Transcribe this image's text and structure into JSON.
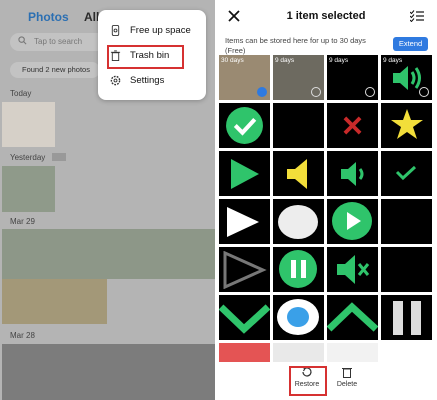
{
  "left": {
    "tabs": {
      "photos": "Photos",
      "albums": "Alb"
    },
    "search_placeholder": "Tap to search",
    "found_banner": "Found 2 new photos",
    "sections": [
      "Today",
      "Yesterday",
      "Mar 29",
      "Mar 28"
    ],
    "menu": {
      "items": [
        {
          "label": "Free up space",
          "icon": "phone-icon"
        },
        {
          "label": "Trash bin",
          "icon": "trash-icon"
        },
        {
          "label": "Settings",
          "icon": "gear-icon"
        }
      ]
    }
  },
  "right": {
    "title": "1 item selected",
    "info": "Items can be stored here for up to 30 days (Free)",
    "extend_label": "Extend",
    "cells": [
      {
        "days": "30 days",
        "selected": true
      },
      {
        "days": "9 days",
        "selected": false
      },
      {
        "days": "9 days",
        "selected": false
      },
      {
        "days": "9 days",
        "selected": false
      }
    ],
    "actions": {
      "restore": "Restore",
      "delete": "Delete"
    }
  },
  "colors": {
    "accent": "#2f7ae0",
    "highlight": "#d63131",
    "green": "#2fc46b"
  }
}
